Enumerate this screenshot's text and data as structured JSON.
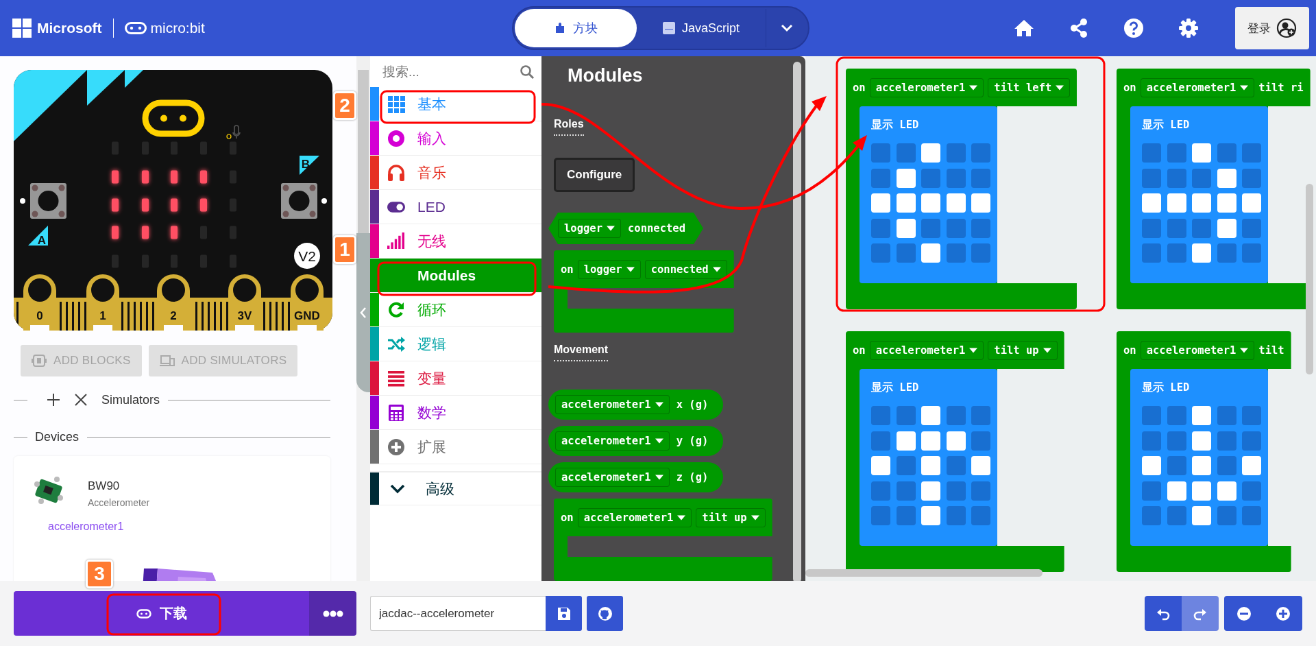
{
  "header": {
    "brand": "Microsoft",
    "product": "micro:bit",
    "editor_tabs": [
      {
        "label": "方块",
        "kind": "blocks",
        "selected": true
      },
      {
        "label": "JavaScript",
        "kind": "js",
        "selected": false
      }
    ],
    "sign_in": "登录"
  },
  "simulator": {
    "leds": [
      [
        false,
        false,
        false,
        false,
        false
      ],
      [
        true,
        true,
        true,
        true,
        false
      ],
      [
        true,
        true,
        true,
        true,
        false
      ],
      [
        true,
        true,
        true,
        false,
        false
      ],
      [
        false,
        false,
        false,
        false,
        false
      ]
    ],
    "pins": [
      "0",
      "1",
      "2",
      "3V",
      "GND"
    ],
    "buttons": [
      "A",
      "B"
    ],
    "version": "V2"
  },
  "sim_actions": [
    {
      "label": "ADD BLOCKS",
      "kind": "blocks",
      "disabled": true
    },
    {
      "label": "ADD SIMULATORS",
      "kind": "simulators",
      "disabled": true
    }
  ],
  "simulators_label": "Simulators",
  "devices_label": "Devices",
  "device": {
    "name": "BW90",
    "type": "Accelerometer",
    "role": "accelerometer1"
  },
  "toolbox": {
    "search_placeholder": "搜索...",
    "categories": [
      {
        "label": "基本",
        "kind": "grid",
        "color": "#1e90ff",
        "selected": false
      },
      {
        "label": "输入",
        "kind": "target",
        "color": "#d400d4",
        "selected": false
      },
      {
        "label": "音乐",
        "kind": "headphones",
        "color": "#e63022",
        "selected": false
      },
      {
        "label": "LED",
        "kind": "toggle",
        "color": "#5c2d91",
        "selected": false
      },
      {
        "label": "无线",
        "kind": "signal",
        "color": "#e3008c",
        "selected": false
      },
      {
        "label": "Modules",
        "kind": "none",
        "color": "#009a00",
        "selected": true
      },
      {
        "label": "循环",
        "kind": "loop",
        "color": "#00aa00",
        "selected": false
      },
      {
        "label": "逻辑",
        "kind": "shuffle",
        "color": "#00a4a6",
        "selected": false
      },
      {
        "label": "变量",
        "kind": "list",
        "color": "#dc143c",
        "selected": false
      },
      {
        "label": "数学",
        "kind": "calculator",
        "color": "#9400d3",
        "selected": false
      },
      {
        "label": "扩展",
        "kind": "plus",
        "color": "#717171",
        "selected": false
      }
    ],
    "advanced": {
      "label": "高级",
      "color": "#002b36"
    }
  },
  "flyout": {
    "title": "Modules",
    "items": [
      {
        "kind": "heading",
        "label": "Roles"
      },
      {
        "kind": "button",
        "label": "Configure"
      },
      {
        "kind": "boolean",
        "fields": [
          {
            "text": "logger",
            "dropdown": true
          },
          {
            "text": "connected",
            "dropdown": false
          }
        ]
      },
      {
        "kind": "event",
        "fields": [
          {
            "text": "on",
            "dropdown": false
          },
          {
            "text": "logger",
            "dropdown": true
          },
          {
            "text": "connected",
            "dropdown": true
          }
        ]
      },
      {
        "kind": "heading",
        "label": "Movement"
      },
      {
        "kind": "value",
        "fields": [
          {
            "text": "accelerometer1",
            "dropdown": true
          },
          {
            "text": "x (g)",
            "dropdown": false
          }
        ]
      },
      {
        "kind": "value",
        "fields": [
          {
            "text": "accelerometer1",
            "dropdown": true
          },
          {
            "text": "y (g)",
            "dropdown": false
          }
        ]
      },
      {
        "kind": "value",
        "fields": [
          {
            "text": "accelerometer1",
            "dropdown": true
          },
          {
            "text": "z (g)",
            "dropdown": false
          }
        ]
      },
      {
        "kind": "event",
        "fields": [
          {
            "text": "on",
            "dropdown": false
          },
          {
            "text": "accelerometer1",
            "dropdown": true
          },
          {
            "text": "tilt up",
            "dropdown": true
          }
        ]
      }
    ]
  },
  "workspace": {
    "blocks": [
      {
        "fields": [
          {
            "text": "on",
            "dropdown": false
          },
          {
            "text": "accelerometer1",
            "dropdown": true
          },
          {
            "text": "tilt left",
            "dropdown": true
          }
        ],
        "statement": {
          "label": "显示 LED",
          "leds": [
            [
              false,
              false,
              true,
              false,
              false
            ],
            [
              false,
              true,
              false,
              false,
              false
            ],
            [
              true,
              true,
              true,
              true,
              true
            ],
            [
              false,
              true,
              false,
              false,
              false
            ],
            [
              false,
              false,
              true,
              false,
              false
            ]
          ]
        }
      },
      {
        "fields": [
          {
            "text": "on",
            "dropdown": false
          },
          {
            "text": "accelerometer1",
            "dropdown": true
          },
          {
            "text": "tilt ri",
            "dropdown": false
          }
        ],
        "statement": {
          "label": "显示 LED",
          "leds": [
            [
              false,
              false,
              true,
              false,
              false
            ],
            [
              false,
              false,
              false,
              true,
              false
            ],
            [
              true,
              true,
              true,
              true,
              true
            ],
            [
              false,
              false,
              false,
              true,
              false
            ],
            [
              false,
              false,
              true,
              false,
              false
            ]
          ]
        }
      },
      {
        "fields": [
          {
            "text": "on",
            "dropdown": false
          },
          {
            "text": "accelerometer1",
            "dropdown": true
          },
          {
            "text": "tilt up",
            "dropdown": true
          }
        ],
        "statement": {
          "label": "显示 LED",
          "leds": [
            [
              false,
              false,
              true,
              false,
              false
            ],
            [
              false,
              true,
              true,
              true,
              false
            ],
            [
              true,
              false,
              true,
              false,
              true
            ],
            [
              false,
              false,
              true,
              false,
              false
            ],
            [
              false,
              false,
              true,
              false,
              false
            ]
          ]
        }
      },
      {
        "fields": [
          {
            "text": "on",
            "dropdown": false
          },
          {
            "text": "accelerometer1",
            "dropdown": true
          },
          {
            "text": "tilt",
            "dropdown": false
          }
        ],
        "statement": {
          "label": "显示 LED",
          "leds": [
            [
              false,
              false,
              true,
              false,
              false
            ],
            [
              false,
              false,
              true,
              false,
              false
            ],
            [
              true,
              false,
              true,
              false,
              true
            ],
            [
              false,
              true,
              true,
              true,
              false
            ],
            [
              false,
              false,
              true,
              false,
              false
            ]
          ]
        }
      }
    ]
  },
  "footer": {
    "download": "下载",
    "project_name": "jacdac--accelerometer",
    "history": [
      {
        "kind": "undo",
        "disabled": false
      },
      {
        "kind": "redo",
        "disabled": true
      }
    ]
  },
  "annotations": {
    "badges": [
      "2",
      "1",
      "3"
    ]
  }
}
